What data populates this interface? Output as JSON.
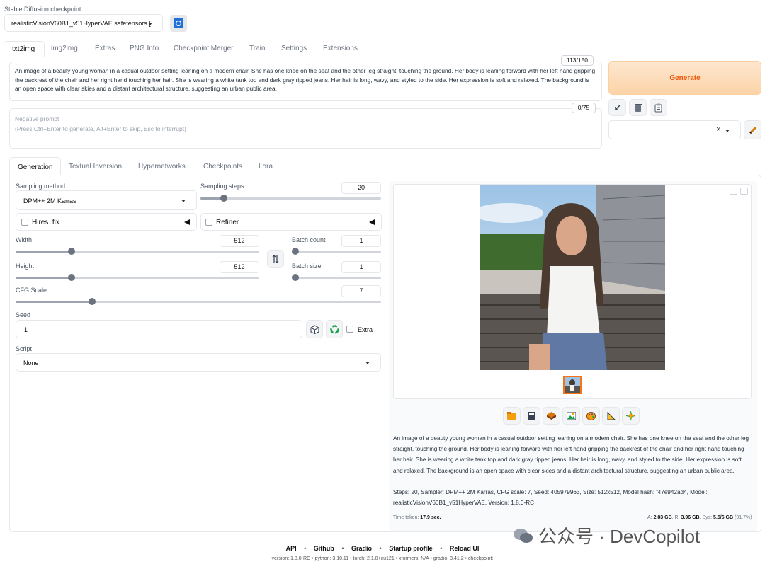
{
  "checkpoint": {
    "label": "Stable Diffusion checkpoint",
    "value": "realisticVisionV60B1_v51HyperVAE.safetensors ["
  },
  "tabs": [
    "txt2img",
    "img2img",
    "Extras",
    "PNG Info",
    "Checkpoint Merger",
    "Train",
    "Settings",
    "Extensions"
  ],
  "prompt": {
    "text": "An image of a beauty young woman in a casual outdoor setting leaning on a modern chair. She has one knee on the seat and the other leg straight, touching the ground. Her body is leaning forward with her left hand gripping the backrest of the chair and her right hand touching her hair. She is wearing a white tank top and dark gray ripped jeans. Her hair is long, wavy, and styled to the side. Her expression is soft and relaxed. The background is an open space with clear skies and a distant architectural structure, suggesting an urban public area.",
    "token_count": "113/150"
  },
  "negative_prompt": {
    "placeholder_line1": "Negative prompt",
    "placeholder_line2": "(Press Ctrl+Enter to generate, Alt+Enter to skip, Esc to interrupt)",
    "token_count": "0/75"
  },
  "generate_label": "Generate",
  "clear_symbol": "×",
  "subtabs": [
    "Generation",
    "Textual Inversion",
    "Hypernetworks",
    "Checkpoints",
    "Lora"
  ],
  "params": {
    "sampling_method_label": "Sampling method",
    "sampling_method": "DPM++ 2M Karras",
    "sampling_steps_label": "Sampling steps",
    "sampling_steps": "20",
    "sampling_steps_level": 0.13,
    "hires_fix": "Hires. fix",
    "refiner": "Refiner",
    "width_label": "Width",
    "width": "512",
    "width_level": 0.23,
    "height_label": "Height",
    "height": "512",
    "height_level": 0.23,
    "batch_count_label": "Batch count",
    "batch_count": "1",
    "batch_count_level": 0.0,
    "batch_size_label": "Batch size",
    "batch_size": "1",
    "batch_size_level": 0.0,
    "cfg_label": "CFG Scale",
    "cfg": "7",
    "cfg_level": 0.21,
    "seed_label": "Seed",
    "seed": "-1",
    "extra_label": "Extra",
    "script_label": "Script",
    "script": "None"
  },
  "output": {
    "info_text": "An image of a beauty young woman in a casual outdoor setting leaning on a modern chair. She has one knee on the seat and the other leg straight, touching the ground. Her body is leaning forward with her left hand gripping the backrest of the chair and her right hand touching her hair. She is wearing a white tank top and dark gray ripped jeans. Her hair is long, wavy, and styled to the side. Her expression is soft and relaxed. The background is an open space with clear skies and a distant architectural structure, suggesting an urban public area.",
    "steps_line1": "Steps: 20, Sampler: DPM++ 2M Karras, CFG scale: 7, Seed: 405979963, Size: 512x512, Model hash: f47e942ad4, Model:",
    "steps_line2": "realisticVisionV60B1_v51HyperVAE, Version: 1.8.0-RC",
    "time_label": "Time taken:",
    "time_value": "17.9 sec.",
    "mem_a_label": "A:",
    "mem_a": "2.83 GB",
    "mem_r_label": "R:",
    "mem_r": "3.96 GB",
    "mem_sys_label": "Sys:",
    "mem_sys": "5.5/6 GB",
    "mem_pct": "(91.7%)"
  },
  "watermark": "公众号 · DevCopilot",
  "footer": {
    "links": [
      "API",
      "Github",
      "Gradio",
      "Startup profile",
      "Reload UI"
    ],
    "separator": "•",
    "version_line": "version: 1.8.0-RC  •  python: 3.10.11  •  torch: 2.1.0+cu121  •  xformers: N/A  •  gradio: 3.41.2  •  checkpoint:"
  },
  "icons": {
    "refresh": "refresh-icon",
    "arrow": "arrow-icon",
    "trash": "trash-icon",
    "clipboard": "clipboard-icon",
    "pencil": "pencil-icon",
    "swap": "swap-icon",
    "dice": "dice-icon",
    "recycle": "recycle-icon"
  },
  "colors": {
    "generate_bg": "#fdd9b5",
    "generate_text": "#ea580c",
    "refresh_bg": "#1e6fd9"
  }
}
